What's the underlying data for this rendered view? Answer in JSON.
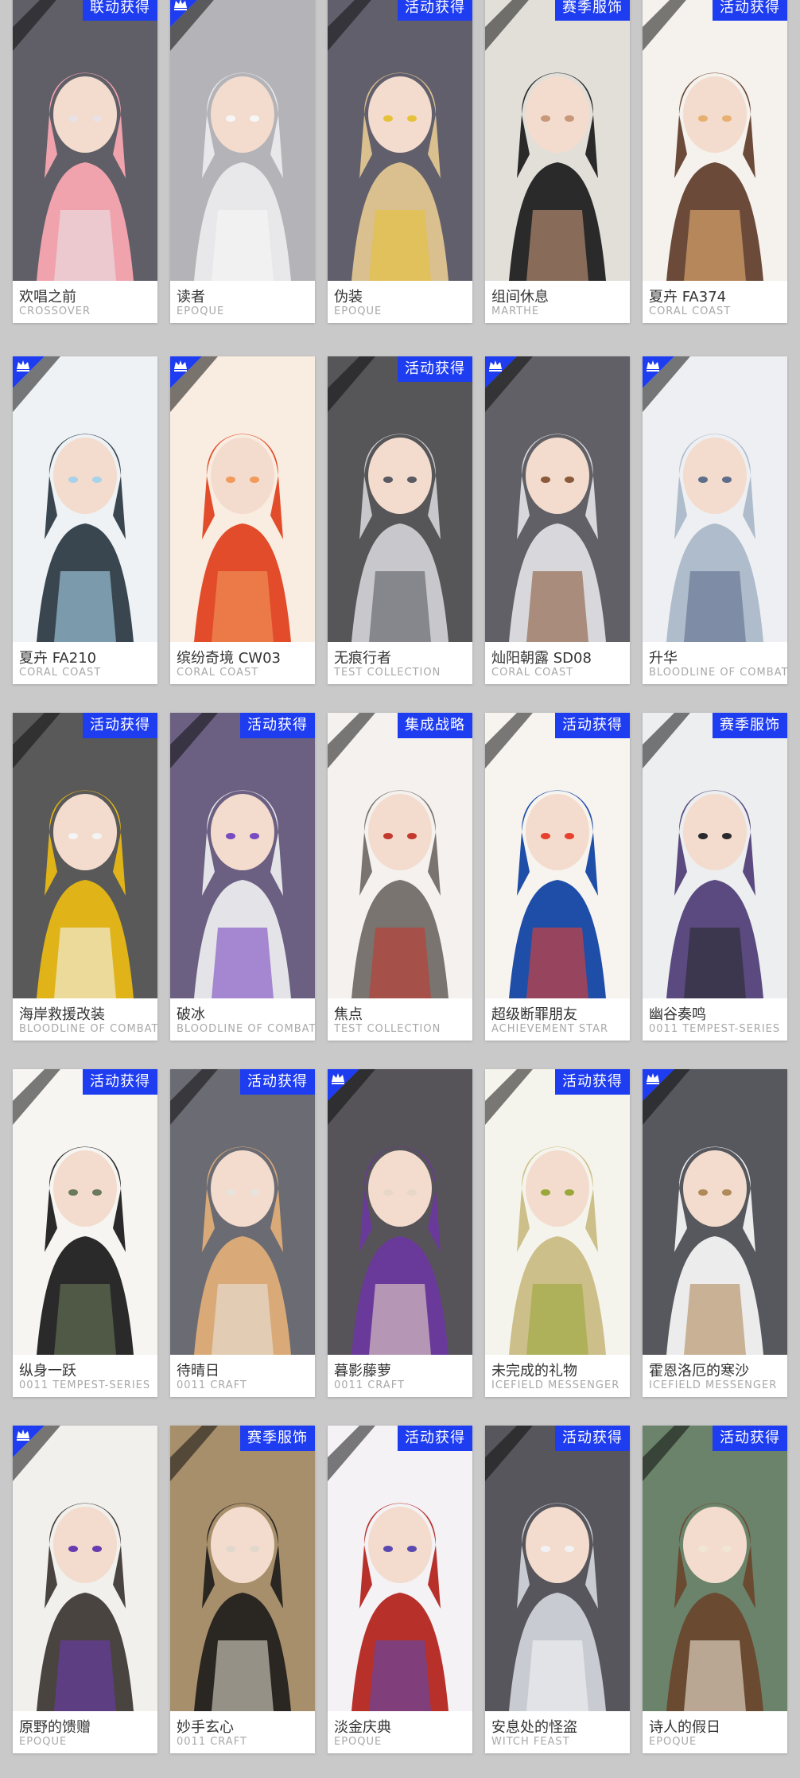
{
  "colors": {
    "background": "#c9c9c9",
    "tag_blue": "#1f3df0",
    "title_text": "#333333",
    "series_text": "#a8a8a8"
  },
  "cards": [
    {
      "title": "欢唱之前",
      "series": "CROSSOVER",
      "tag": "联动获得",
      "badge": "",
      "palette": [
        "#f0a3ad",
        "#2b2a36",
        "#e8e2e6"
      ]
    },
    {
      "title": "读者",
      "series": "EPOQUE",
      "tag": "",
      "badge": "corner-badge-icon",
      "palette": [
        "#e8e8ea",
        "#9a9aa0",
        "#f6f6f6"
      ]
    },
    {
      "title": "伪装",
      "series": "EPOQUE",
      "tag": "活动获得",
      "badge": "",
      "palette": [
        "#d9c08e",
        "#2e2a3c",
        "#e6c13a"
      ]
    },
    {
      "title": "组间休息",
      "series": "MARTHE",
      "tag": "赛季服饰",
      "badge": "",
      "palette": [
        "#2a2a2a",
        "#d8d4cc",
        "#c9977a"
      ]
    },
    {
      "title": "夏卉 FA374",
      "series": "CORAL COAST",
      "tag": "活动获得",
      "badge": "",
      "palette": [
        "#6b4a3a",
        "#f2ece6",
        "#e8b070"
      ]
    },
    {
      "title": "夏卉 FA210",
      "series": "CORAL COAST",
      "tag": "",
      "badge": "corner-badge-icon",
      "palette": [
        "#39464f",
        "#e9eef2",
        "#a8d2ea"
      ]
    },
    {
      "title": "缤纷奇境 CW03",
      "series": "CORAL COAST",
      "tag": "",
      "badge": "corner-badge-icon",
      "palette": [
        "#e24c2a",
        "#f7e6d6",
        "#f19a5e"
      ]
    },
    {
      "title": "无痕行者",
      "series": "TEST COLLECTION",
      "tag": "活动获得",
      "badge": "",
      "palette": [
        "#c8c8cc",
        "#1e1e22",
        "#5a5a62"
      ]
    },
    {
      "title": "灿阳朝露 SD08",
      "series": "CORAL COAST",
      "tag": "",
      "badge": "corner-badge-icon",
      "palette": [
        "#d8d8dc",
        "#2b2b33",
        "#8a5a3a"
      ]
    },
    {
      "title": "升华",
      "series": "BLOODLINE OF COMBAT",
      "tag": "",
      "badge": "corner-badge-icon",
      "palette": [
        "#aebccc",
        "#e8eaee",
        "#5e6e8a"
      ]
    },
    {
      "title": "海岸救援改装",
      "series": "BLOODLINE OF COMBAT",
      "tag": "活动获得",
      "badge": "",
      "palette": [
        "#e0b418",
        "#222222",
        "#f4f4f4"
      ]
    },
    {
      "title": "破冰",
      "series": "BLOODLINE OF COMBAT",
      "tag": "活动获得",
      "badge": "",
      "palette": [
        "#e4e4e8",
        "#3a2a58",
        "#7a4ac0"
      ]
    },
    {
      "title": "焦点",
      "series": "TEST COLLECTION",
      "tag": "集成战略",
      "badge": "",
      "palette": [
        "#7a7470",
        "#f0ece8",
        "#c23a2e"
      ]
    },
    {
      "title": "超级断罪朋友",
      "series": "ACHIEVEMENT STAR",
      "tag": "活动获得",
      "badge": "",
      "palette": [
        "#1f4ea8",
        "#f4f0ea",
        "#e8402e"
      ]
    },
    {
      "title": "幽谷奏鸣",
      "series": "0011 TEMPEST-SERIES",
      "tag": "赛季服饰",
      "badge": "",
      "palette": [
        "#5a4a80",
        "#e6e8ea",
        "#2a2a2e"
      ]
    },
    {
      "title": "纵身一跃",
      "series": "0011 TEMPEST-SERIES",
      "tag": "活动获得",
      "badge": "",
      "palette": [
        "#2a2a2a",
        "#f4f2ee",
        "#6a7a5a"
      ]
    },
    {
      "title": "待晴日",
      "series": "0011 CRAFT",
      "tag": "活动获得",
      "badge": "",
      "palette": [
        "#d9aa78",
        "#3a3a44",
        "#e8e2dc"
      ]
    },
    {
      "title": "暮影藤萝",
      "series": "0011 CRAFT",
      "tag": "",
      "badge": "corner-badge-icon",
      "palette": [
        "#6a3a9a",
        "#1e1a22",
        "#e8d6c8"
      ]
    },
    {
      "title": "未完成的礼物",
      "series": "ICEFIELD MESSENGER",
      "tag": "活动获得",
      "badge": "",
      "palette": [
        "#cdbf8a",
        "#f2f0e6",
        "#9aa83a"
      ]
    },
    {
      "title": "霍恩洛厄的寒沙",
      "series": "ICEFIELD MESSENGER",
      "tag": "",
      "badge": "corner-badge-icon",
      "palette": [
        "#ececec",
        "#1e2028",
        "#b08a5a"
      ]
    },
    {
      "title": "原野的馈赠",
      "series": "EPOQUE",
      "tag": "",
      "badge": "corner-badge-icon",
      "palette": [
        "#4a4440",
        "#ecebe6",
        "#6a3ab0"
      ]
    },
    {
      "title": "妙手玄心",
      "series": "0011 CRAFT",
      "tag": "赛季服饰",
      "badge": "",
      "palette": [
        "#2a2622",
        "#8a6a3a",
        "#e0d8cc"
      ]
    },
    {
      "title": "淡金庆典",
      "series": "EPOQUE",
      "tag": "活动获得",
      "badge": "",
      "palette": [
        "#b8302a",
        "#f0eef2",
        "#5a4ab0"
      ]
    },
    {
      "title": "安息处的怪盗",
      "series": "WITCH FEAST",
      "tag": "活动获得",
      "badge": "",
      "palette": [
        "#c8ccd2",
        "#1e1e26",
        "#f2f2f4"
      ]
    },
    {
      "title": "诗人的假日",
      "series": "EPOQUE",
      "tag": "活动获得",
      "badge": "",
      "palette": [
        "#6a4a30",
        "#3a5a3a",
        "#efe6d6"
      ]
    }
  ]
}
